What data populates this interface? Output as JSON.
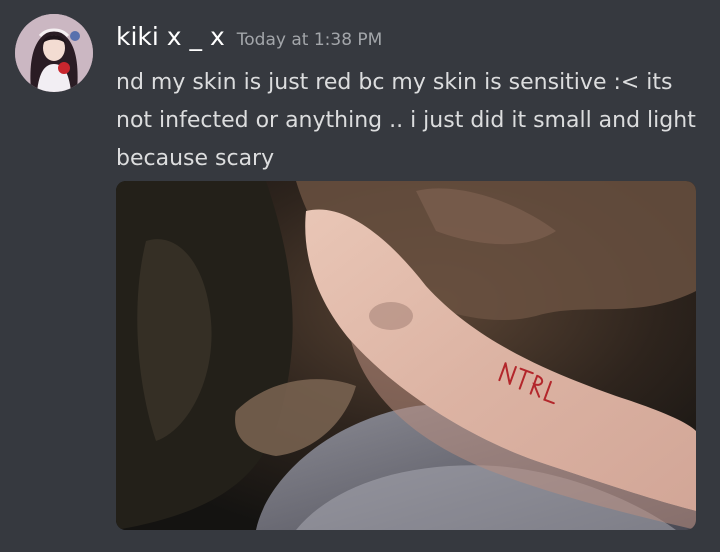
{
  "message": {
    "author": "kiki x _ x",
    "timestamp": "Today at 1:38 PM",
    "content": "nd my skin is just red bc my skin is sensitive :< its not infected or anything .. i just did it small and light because scary",
    "attachment": {
      "type": "image",
      "visible_text": "NTRL"
    }
  },
  "colors": {
    "background": "#36393f",
    "username": "#ffffff",
    "timestamp": "#a3a6aa",
    "message_text": "#dcddde"
  },
  "icons": {
    "avatar": "user-avatar-image"
  }
}
